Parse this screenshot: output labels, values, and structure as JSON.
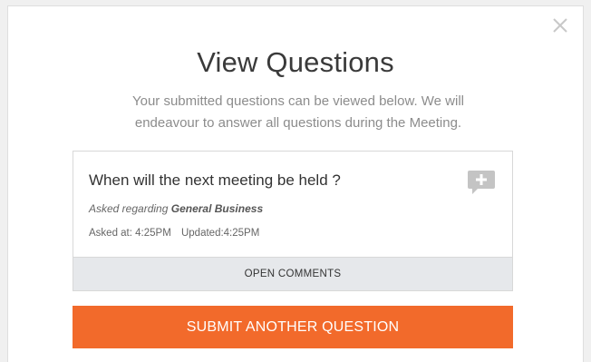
{
  "modal": {
    "title": "View Questions",
    "subtitle": "Your submitted questions can be viewed below. We will endeavour to answer all questions during the Meeting.",
    "close_icon": "close-icon"
  },
  "question": {
    "text": "When will the next meeting be held ?",
    "asked_regarding_prefix": "Asked regarding",
    "topic": "General Business",
    "asked_at": "Asked at: 4:25PM",
    "updated": "Updated:4:25PM",
    "comment_icon": "add-comment-icon",
    "open_comments_label": "OPEN COMMENTS"
  },
  "actions": {
    "submit_label": "SUBMIT ANOTHER QUESTION"
  },
  "colors": {
    "accent": "#f26a2b",
    "comment_icon": "#c4c4c4",
    "footer_bg": "#e6e8eb"
  }
}
